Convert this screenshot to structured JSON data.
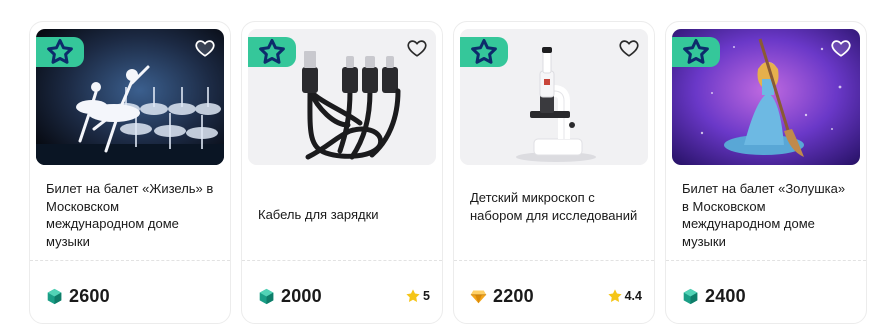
{
  "colors": {
    "badge_bg": "#35c79a",
    "badge_star": "#0d2b6b",
    "gem_teal": "#1a9e86",
    "gem_gold": "#f3a51b",
    "rating_star": "#f5c518"
  },
  "cards": [
    {
      "title": "Билет на балет «Жизель» в Московском международном доме музыки",
      "price": "2600",
      "price_icon": "teal-gem-icon",
      "rating": null
    },
    {
      "title": "Кабель для зарядки",
      "price": "2000",
      "price_icon": "teal-gem-icon",
      "rating": "5"
    },
    {
      "title": "Детский микроскоп с набором для исследований",
      "price": "2200",
      "price_icon": "gold-gem-icon",
      "rating": "4.4"
    },
    {
      "title": "Билет на балет «Золушка» в Московском международном доме музыки",
      "price": "2400",
      "price_icon": "teal-gem-icon",
      "rating": null
    }
  ]
}
